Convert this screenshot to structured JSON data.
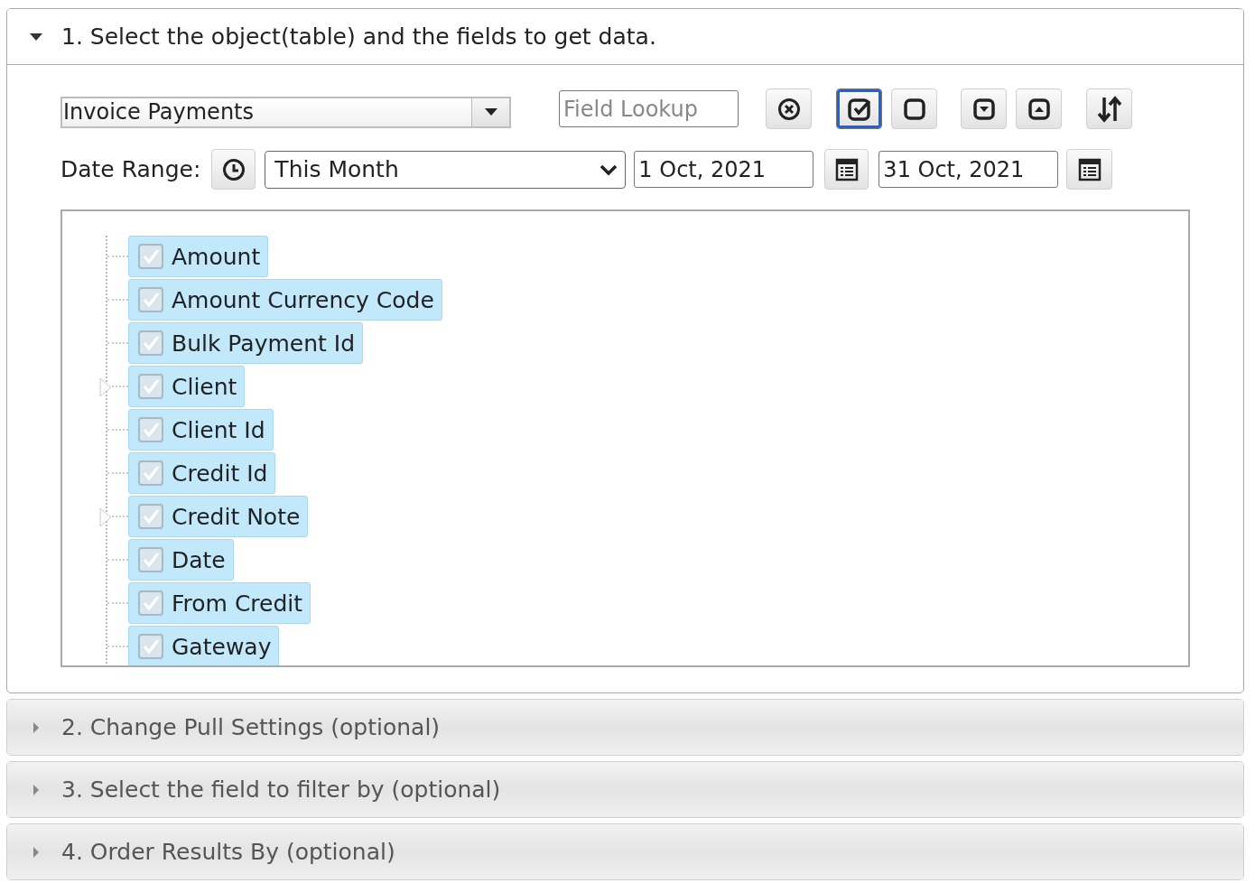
{
  "sections": [
    {
      "title": "1. Select the object(table) and the fields to get data.",
      "expanded": true
    },
    {
      "title": "2. Change Pull Settings (optional)",
      "expanded": false
    },
    {
      "title": "3. Select the field to filter by (optional)",
      "expanded": false
    },
    {
      "title": "4. Order Results By (optional)",
      "expanded": false
    }
  ],
  "object_select": {
    "value": "Invoice Payments"
  },
  "field_lookup": {
    "placeholder": "Field Lookup"
  },
  "toolbar": [
    {
      "kind": "clear",
      "focused": false
    },
    {
      "kind": "check-all",
      "focused": true
    },
    {
      "kind": "uncheck-all",
      "focused": false
    },
    {
      "kind": "expand",
      "focused": false
    },
    {
      "kind": "collapse",
      "focused": false
    },
    {
      "kind": "sort",
      "focused": false
    }
  ],
  "date_range": {
    "label": "Date Range:",
    "preset": "This Month",
    "from": "1 Oct, 2021",
    "to": "31 Oct, 2021"
  },
  "fields": [
    {
      "label": "Amount",
      "checked": true,
      "has_children": false
    },
    {
      "label": "Amount Currency Code",
      "checked": true,
      "has_children": false
    },
    {
      "label": "Bulk Payment Id",
      "checked": true,
      "has_children": false
    },
    {
      "label": "Client",
      "checked": true,
      "has_children": true
    },
    {
      "label": "Client Id",
      "checked": true,
      "has_children": false
    },
    {
      "label": "Credit Id",
      "checked": true,
      "has_children": false
    },
    {
      "label": "Credit Note",
      "checked": true,
      "has_children": true
    },
    {
      "label": "Date",
      "checked": true,
      "has_children": false
    },
    {
      "label": "From Credit",
      "checked": true,
      "has_children": false
    },
    {
      "label": "Gateway",
      "checked": true,
      "has_children": false
    }
  ]
}
